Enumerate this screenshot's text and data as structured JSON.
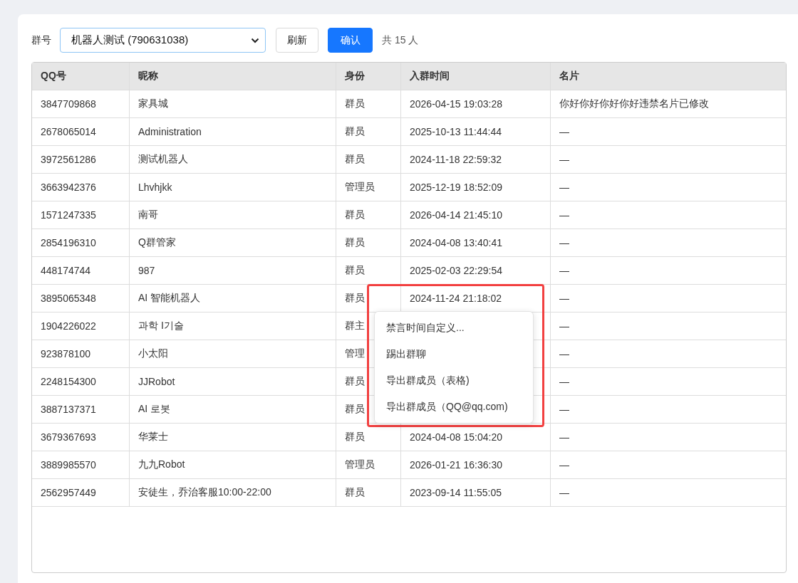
{
  "toolbar": {
    "group_label": "群号",
    "group_select": {
      "value": "机器人测试 (790631038)"
    },
    "refresh_button": "刷新",
    "confirm_button": "确认",
    "count": "共 15 人"
  },
  "table": {
    "columns": [
      "QQ号",
      "昵称",
      "身份",
      "入群时间",
      "名片"
    ],
    "rows": [
      {
        "qq": "3847709868",
        "nickname": "家具城",
        "role": "群员",
        "joined": "2026-04-15 19:03:28",
        "card": "你好你好你好你好违禁名片已修改"
      },
      {
        "qq": "2678065014",
        "nickname": "Administration",
        "role": "群员",
        "joined": "2025-10-13 11:44:44",
        "card": "—"
      },
      {
        "qq": "3972561286",
        "nickname": "测试机器人",
        "role": "群员",
        "joined": "2024-11-18 22:59:32",
        "card": "—"
      },
      {
        "qq": "3663942376",
        "nickname": "Lhvhjkk",
        "role": "管理员",
        "joined": "2025-12-19 18:52:09",
        "card": "—"
      },
      {
        "qq": "1571247335",
        "nickname": "南哥",
        "role": "群员",
        "joined": "2026-04-14 21:45:10",
        "card": "—"
      },
      {
        "qq": "2854196310",
        "nickname": "Q群管家",
        "role": "群员",
        "joined": "2024-04-08 13:40:41",
        "card": "—"
      },
      {
        "qq": "448174744",
        "nickname": "987",
        "role": "群员",
        "joined": "2025-02-03 22:29:54",
        "card": "—"
      },
      {
        "qq": "3895065348",
        "nickname": "AI 智能机器人",
        "role": "群员",
        "joined": "2024-11-24 21:18:02",
        "card": "—"
      },
      {
        "qq": "1904226022",
        "nickname": "과학 I기술",
        "role": "群主",
        "card": "—"
      },
      {
        "qq": "923878100",
        "nickname": "小太阳",
        "role": "管理",
        "card": "—"
      },
      {
        "qq": "2248154300",
        "nickname": "JJRobot",
        "role": "群员",
        "card": "—"
      },
      {
        "qq": "3887137371",
        "nickname": "AI 로봇",
        "role": "群员",
        "card": "—"
      },
      {
        "qq": "3679367693",
        "nickname": "华莱士",
        "role": "群员",
        "joined": "2024-04-08 15:04:20",
        "card": "—"
      },
      {
        "qq": "3889985570",
        "nickname": "九九Robot",
        "role": "管理员",
        "joined": "2026-01-21 16:36:30",
        "card": "—"
      },
      {
        "qq": "2562957449",
        "nickname": "安徒生，乔治客服10:00-22:00",
        "role": "群员",
        "joined": "2023-09-14 11:55:05",
        "card": "—"
      }
    ]
  },
  "context_menu": {
    "items": [
      "禁言时间自定义...",
      "踢出群聊",
      "导出群成员（表格)",
      "导出群成员（QQ@qq.com)"
    ]
  }
}
